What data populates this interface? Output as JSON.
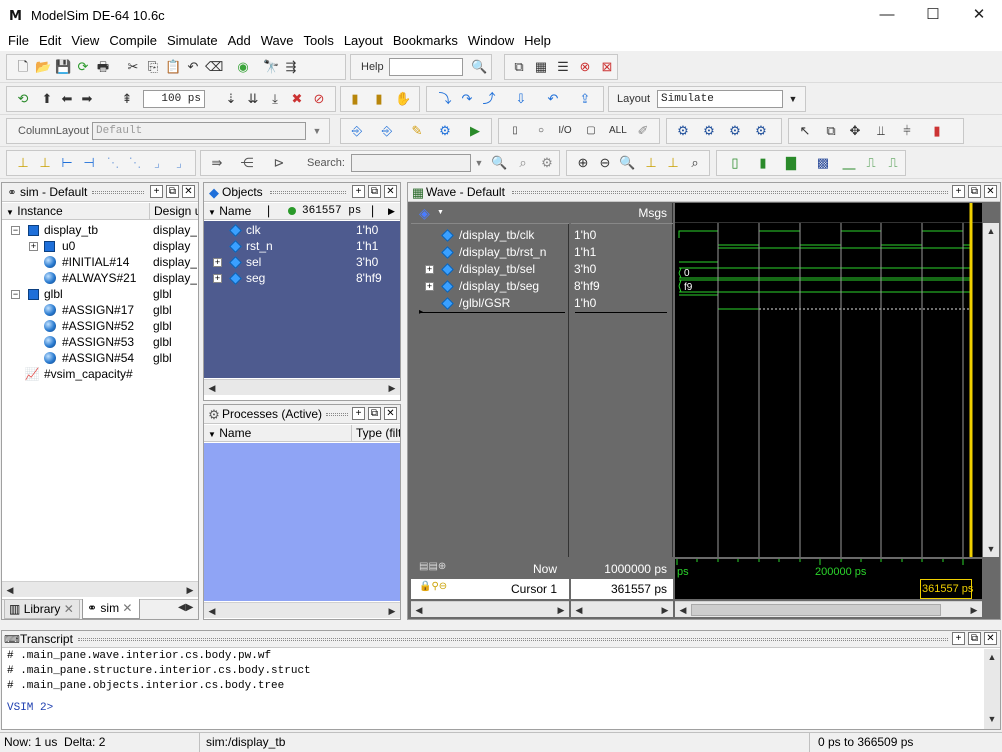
{
  "app": {
    "title": "ModelSim DE-64 10.6c",
    "logo_glyph": "M"
  },
  "window_controls": {
    "minimize": "—",
    "maximize": "☐",
    "close": "✕"
  },
  "menu": [
    "File",
    "Edit",
    "View",
    "Compile",
    "Simulate",
    "Add",
    "Wave",
    "Tools",
    "Layout",
    "Bookmarks",
    "Window",
    "Help"
  ],
  "toolbar": {
    "help_label": "Help",
    "help_value": "",
    "run_length": "100 ps",
    "layout_label": "Layout",
    "layout_value": "Simulate",
    "column_layout_label": "ColumnLayout",
    "column_layout_value": "Default",
    "search_label": "Search:",
    "search_value": ""
  },
  "sim_panel": {
    "title": "sim - Default",
    "columns": [
      "Instance",
      "Design u"
    ],
    "rows": [
      {
        "name": "display_tb",
        "design": "display_t",
        "icon": "cube-icon",
        "expander": "−"
      },
      {
        "name": "u0",
        "design": "display",
        "icon": "cube-icon",
        "expander": "+"
      },
      {
        "name": "#INITIAL#14",
        "design": "display_t",
        "icon": "process-ball-icon",
        "expander": ""
      },
      {
        "name": "#ALWAYS#21",
        "design": "display_t",
        "icon": "process-ball-icon",
        "expander": ""
      },
      {
        "name": "glbl",
        "design": "glbl",
        "icon": "cube-icon",
        "expander": "−"
      },
      {
        "name": "#ASSIGN#17",
        "design": "glbl",
        "icon": "process-ball-icon",
        "expander": ""
      },
      {
        "name": "#ASSIGN#52",
        "design": "glbl",
        "icon": "process-ball-icon",
        "expander": ""
      },
      {
        "name": "#ASSIGN#53",
        "design": "glbl",
        "icon": "process-ball-icon",
        "expander": ""
      },
      {
        "name": "#ASSIGN#54",
        "design": "glbl",
        "icon": "process-ball-icon",
        "expander": ""
      },
      {
        "name": "#vsim_capacity#",
        "design": "",
        "icon": "capacity-icon",
        "expander": ""
      }
    ],
    "tabs": [
      {
        "label": "Library",
        "icon": "library-icon"
      },
      {
        "label": "sim",
        "icon": "sim-icon"
      }
    ]
  },
  "objects_panel": {
    "title": "Objects",
    "name_col": "Name",
    "time_value": "361557 ps",
    "rows": [
      {
        "name": "clk",
        "value": "1'h0",
        "expander": ""
      },
      {
        "name": "rst_n",
        "value": "1'h1",
        "expander": ""
      },
      {
        "name": "sel",
        "value": "3'h0",
        "expander": "+"
      },
      {
        "name": "seg",
        "value": "8'hf9",
        "expander": "+"
      }
    ]
  },
  "processes_panel": {
    "title": "Processes (Active)",
    "columns": [
      "Name",
      "Type (filt"
    ]
  },
  "wave_panel": {
    "title": "Wave - Default",
    "msgs_header": "Msgs",
    "signals": [
      {
        "name": "/display_tb/clk",
        "value": "1'h0",
        "expander": ""
      },
      {
        "name": "/display_tb/rst_n",
        "value": "1'h1",
        "expander": ""
      },
      {
        "name": "/display_tb/sel",
        "value": "3'h0",
        "expander": "+"
      },
      {
        "name": "/display_tb/seg",
        "value": "8'hf9",
        "expander": "+"
      },
      {
        "name": "/glbl/GSR",
        "value": "1'h0",
        "expander": ""
      }
    ],
    "bus_labels": {
      "sel": "0",
      "seg": "f9"
    },
    "now_label": "Now",
    "now_value": "1000000 ps",
    "cursor_label": "Cursor 1",
    "cursor_value": "361557 ps",
    "timeline_left": "ps",
    "timeline_mid": "200000 ps",
    "cursor_readout": "361557 ps",
    "colors": {
      "wave_green": "#2bd42b",
      "cursor_yellow": "#f0d000",
      "bg": "#000000"
    }
  },
  "transcript": {
    "title": "Transcript",
    "lines": [
      "# .main_pane.wave.interior.cs.body.pw.wf",
      "# .main_pane.structure.interior.cs.body.struct",
      "# .main_pane.objects.interior.cs.body.tree"
    ],
    "prompt": "VSIM 2>"
  },
  "statusbar": {
    "now": "Now: 1 us",
    "delta": "Delta: 2",
    "context": "sim:/display_tb",
    "range": "0 ps to 366509 ps"
  }
}
